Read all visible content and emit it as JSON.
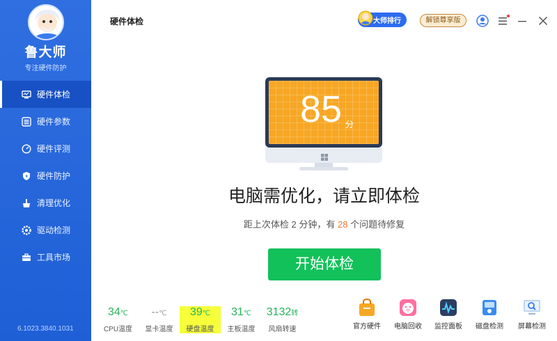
{
  "brand": {
    "name": "鲁大师",
    "tagline": "专注硬件防护"
  },
  "sidebar": {
    "items": [
      {
        "label": "硬件体检",
        "icon": "monitor-check-icon",
        "active": true
      },
      {
        "label": "硬件参数",
        "icon": "list-params-icon"
      },
      {
        "label": "硬件评测",
        "icon": "gauge-icon"
      },
      {
        "label": "硬件防护",
        "icon": "shield-icon"
      },
      {
        "label": "清理优化",
        "icon": "broom-icon"
      },
      {
        "label": "驱动检测",
        "icon": "gear-drive-icon"
      },
      {
        "label": "工具市场",
        "icon": "toolbox-icon"
      }
    ],
    "version": "6.1023.3840.1031"
  },
  "header": {
    "title": "硬件体检",
    "master_rank": "大师排行",
    "unlock": "解锁尊享版"
  },
  "main": {
    "score": "85",
    "score_unit": "分",
    "headline": "电脑需优化，请立即体检",
    "sub_prefix": "距上次体检 2 分钟，有",
    "issues": "28",
    "sub_suffix": "个问题待修复",
    "start_button": "开始体检"
  },
  "stats": [
    {
      "value": "34",
      "unit": "℃",
      "label": "CPU温度"
    },
    {
      "value": "--",
      "unit": "℃",
      "label": "显卡温度"
    },
    {
      "value": "39",
      "unit": "℃",
      "label": "硬盘温度",
      "highlight": true
    },
    {
      "value": "31",
      "unit": "℃",
      "label": "主板温度"
    },
    {
      "value": "3132",
      "unit": "转",
      "label": "风扇转速"
    }
  ],
  "tools": [
    {
      "label": "官方硬件",
      "icon": "shopping-bag-icon"
    },
    {
      "label": "电脑回收",
      "icon": "pig-recycle-icon"
    },
    {
      "label": "监控面板",
      "icon": "monitor-panel-icon"
    },
    {
      "label": "磁盘检测",
      "icon": "disk-check-icon"
    },
    {
      "label": "屏幕检测",
      "icon": "screen-check-icon"
    }
  ],
  "colors": {
    "sidebar": "#2266dd",
    "accent_orange": "#f7a724",
    "start_green": "#12c15a",
    "stat_green": "#25b45a",
    "issue_orange": "#f07a2c"
  }
}
